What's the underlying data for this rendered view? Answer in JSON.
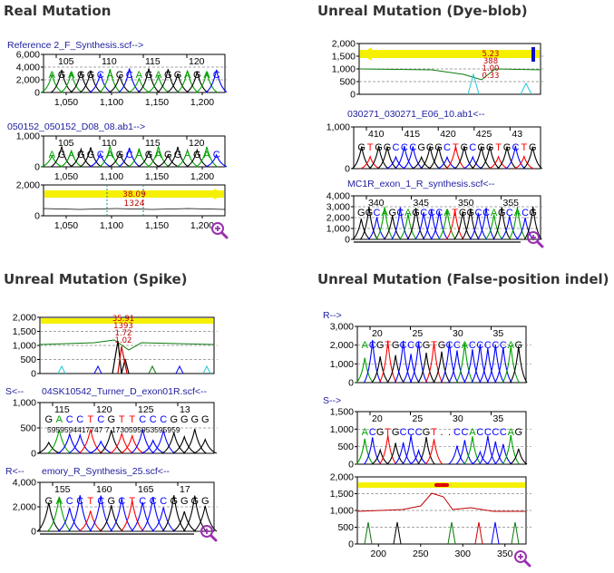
{
  "sections": {
    "real": {
      "heading": "Real Mutation",
      "ref_label": "Reference 2_F_Synthesis.scf-->",
      "ref_yticks": [
        "6,000",
        "4,000",
        "2,000",
        "0"
      ],
      "ref_positions": [
        "105",
        "110",
        "115",
        "120"
      ],
      "ref_bases": "AGAGGCAGCAGAGGAGAC",
      "ref_xticks": [
        "1,050",
        "1,100",
        "1,150",
        "1,200"
      ],
      "sample_label": "050152_050152_D08_08.ab1-->",
      "sample_yticks": [
        "1,000",
        "0"
      ],
      "sample_positions": [
        "105",
        "110",
        "115",
        "120"
      ],
      "sample_bases": "AGAGGCAGCAGAGGAGAC",
      "sample_xticks": [
        "1,050",
        "1,100",
        "1,150",
        "1,200"
      ],
      "diff_yticks": [
        "2,000",
        "0"
      ],
      "diff_values": [
        "38.09",
        "1324"
      ],
      "diff_xticks": [
        "1,050",
        "1,100",
        "1,150",
        "1,200"
      ]
    },
    "dyeblob": {
      "heading": "Unreal Mutation (Dye-blob)",
      "diff_yticks": [
        "2,000",
        "1,500",
        "1,000",
        "500",
        "0"
      ],
      "diff_values": [
        "5.23",
        "388",
        "1.00",
        "0.33"
      ],
      "sample_label": "030271_030271_E06_10.ab1<--",
      "sample_yticks": [
        "1,000",
        "0"
      ],
      "sample_positions": [
        "410",
        "415",
        "420",
        "425",
        "43"
      ],
      "sample_bases": "GTGGCCCGGGCTGCGGTGCTG",
      "ref_label": "MC1R_exon_1_R_synthesis.scf<--",
      "ref_yticks": [
        "4,000",
        "3,000",
        "2,000",
        "1,000",
        "0"
      ],
      "ref_positions": [
        "340",
        "345",
        "350",
        "355"
      ],
      "ref_bases": "GGCAGCAGCCCATGGCCAGCACG"
    },
    "spike": {
      "heading": "Unreal Mutation (Spike)",
      "diff_yticks": [
        "2,000",
        "1,500",
        "1,000",
        "500",
        "0"
      ],
      "diff_values": [
        "35.91",
        "1393",
        "1.72",
        "1.02"
      ],
      "sample_label": "04SK10542_Turner_D_exon01R.scf<--",
      "sample_prefix": "S<--",
      "sample_yticks": [
        "1,000",
        "500",
        "0"
      ],
      "sample_positions": [
        "115",
        "120",
        "125",
        "13"
      ],
      "sample_bases": "GACCTCGTTCCCGGGG",
      "sample_qual": "5959594417747   7 1730595953595959",
      "ref_prefix": "R<--",
      "ref_label": "emory_R_Synthesis_25.scf<--",
      "ref_yticks": [
        "4,000",
        "2,000",
        "0"
      ],
      "ref_positions": [
        "155",
        "160",
        "165",
        "17"
      ],
      "ref_bases": "GACCTCGCTCCCGGGG"
    },
    "indel": {
      "heading": "Unreal Mutation (False-position indel)",
      "ref_prefix": "R-->",
      "ref_yticks": [
        "3,000",
        "2,000",
        "1,000",
        "0"
      ],
      "ref_positions": [
        "20",
        "25",
        "30",
        "35"
      ],
      "ref_bases": "ACGTGCCCGTGCCACCCCCAG",
      "sample_prefix": "S-->",
      "sample_yticks": [
        "1,500",
        "1,000",
        "500",
        "0"
      ],
      "sample_positions": [
        "20",
        "25",
        "30",
        "35"
      ],
      "sample_bases": "ACGTGCCCGT..CCACCCCAG",
      "diff_yticks": [
        "2,000",
        "1,500",
        "1,000",
        "500",
        "0"
      ],
      "diff_xticks": [
        "200",
        "250",
        "300",
        "350"
      ]
    }
  },
  "colors": {
    "A": "#00a000",
    "C": "#0000ff",
    "G": "#000000",
    "T": "#ff0000",
    "highlight": "#f5f000",
    "difference_line": "#c00000",
    "label": "#2020a0",
    "zoom_icon": "#9a30b0"
  },
  "icons": [
    "zoom-in-icon"
  ]
}
